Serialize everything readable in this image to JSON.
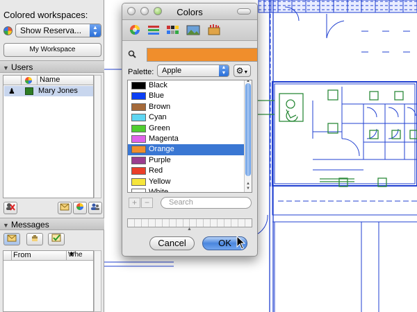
{
  "workspace": {
    "label": "Colored workspaces:",
    "select_value": "Show Reserva...",
    "my_workspace_button": "My Workspace"
  },
  "users": {
    "header": "Users",
    "column_name": "Name",
    "rows": [
      {
        "name": "Mary Jones",
        "color": "#2e7d25"
      }
    ]
  },
  "messages": {
    "header": "Messages",
    "column_from": "From",
    "column_when": "Whe"
  },
  "colors_dialog": {
    "title": "Colors",
    "current_color": "#f08e2c",
    "palette_label": "Palette:",
    "palette_value": "Apple",
    "search_placeholder": "Search",
    "cancel_label": "Cancel",
    "ok_label": "OK",
    "colors": [
      {
        "name": "Black",
        "hex": "#000000"
      },
      {
        "name": "Blue",
        "hex": "#0b3ff5"
      },
      {
        "name": "Brown",
        "hex": "#a56a3a"
      },
      {
        "name": "Cyan",
        "hex": "#5ed6f2"
      },
      {
        "name": "Green",
        "hex": "#4fce2f"
      },
      {
        "name": "Magenta",
        "hex": "#e062ea"
      },
      {
        "name": "Orange",
        "hex": "#f08e2c",
        "selected": true
      },
      {
        "name": "Purple",
        "hex": "#9b3d8f"
      },
      {
        "name": "Red",
        "hex": "#ea3f2a"
      },
      {
        "name": "Yellow",
        "hex": "#f6e53b"
      },
      {
        "name": "White",
        "hex": "#ffffff"
      }
    ]
  },
  "accent": "#3a77d3",
  "blueprint_line_color": "#1f3fd0",
  "blueprint_fixture_color": "#2c8a3a"
}
